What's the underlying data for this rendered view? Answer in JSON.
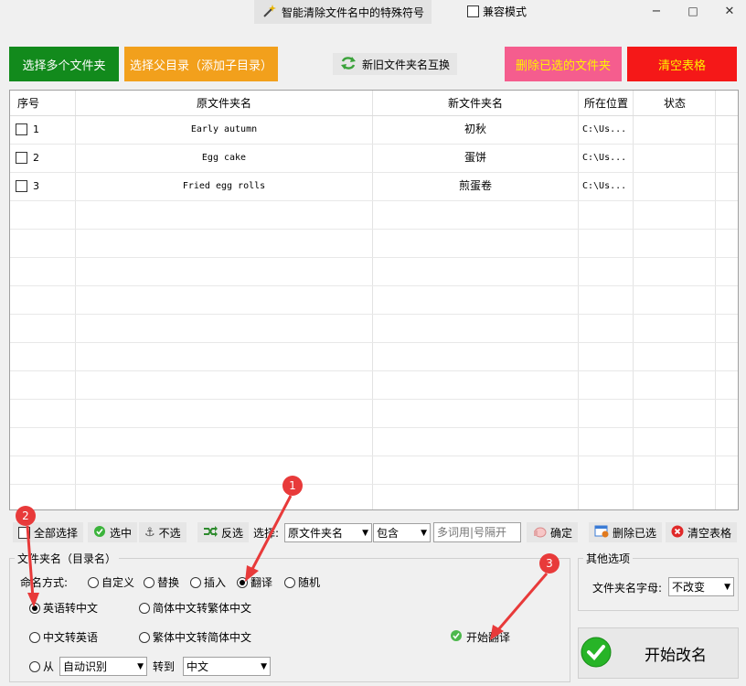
{
  "window": {
    "title": "智能清除文件名中的特殊符号",
    "compat_label": "兼容模式",
    "min": "−",
    "max": "□",
    "close": "✕"
  },
  "top_buttons": {
    "multi": "选择多个文件夹",
    "parent": "选择父目录（添加子目录）",
    "swap": "新旧文件夹名互换",
    "delete": "删除已选的文件夹",
    "clear": "清空表格"
  },
  "colors": {
    "green": "#128a1c",
    "orange": "#f2a01c",
    "pink": "#f55d8e",
    "red": "#f51818",
    "badge": "#e83a3a"
  },
  "table": {
    "headers": [
      "序号",
      "原文件夹名",
      "新文件夹名",
      "所在位置",
      "状态"
    ],
    "rows": [
      {
        "no": "1",
        "orig": "Early autumn",
        "new": "初秋",
        "loc": "C:\\Us...",
        "status": ""
      },
      {
        "no": "2",
        "orig": "Egg cake",
        "new": "蛋饼",
        "loc": "C:\\Us...",
        "status": ""
      },
      {
        "no": "3",
        "orig": "Fried egg rolls",
        "new": "煎蛋卷",
        "loc": "C:\\Us...",
        "status": ""
      }
    ]
  },
  "toolbar": {
    "select_all": "全部选择",
    "select": "选中",
    "unselect": "不选",
    "invert": "反选",
    "filter_label": "选择:",
    "filter_field": "原文件夹名",
    "filter_mode": "包含",
    "filter_placeholder": "多词用|号隔开",
    "confirm": "确定",
    "delete_selected": "删除已选",
    "clear_table": "清空表格"
  },
  "folder_group": {
    "title": "文件夹名（目录名）",
    "method_label": "命名方式:",
    "methods": [
      "自定义",
      "替换",
      "插入",
      "翻译",
      "随机"
    ],
    "selected_method": "翻译",
    "opt_en2zh": "英语转中文",
    "opt_s2t": "简体中文转繁体中文",
    "opt_zh2en": "中文转英语",
    "opt_t2s": "繁体中文转简体中文",
    "from_label": "从",
    "from_value": "自动识别",
    "to_label": "转到",
    "to_value": "中文",
    "start_translate": "开始翻译"
  },
  "other_group": {
    "title": "其他选项",
    "case_label": "文件夹名字母:",
    "case_value": "不改变"
  },
  "start_rename": "开始改名",
  "badges": [
    "1",
    "2",
    "3"
  ]
}
